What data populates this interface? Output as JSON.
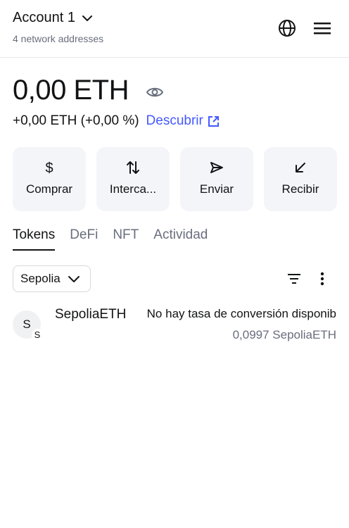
{
  "header": {
    "account_name": "Account 1",
    "addresses_label": "4 network addresses"
  },
  "balance": {
    "amount": "0,00 ETH",
    "change": "+0,00 ETH (+0,00 %)",
    "discover_label": "Descubrir"
  },
  "actions": [
    {
      "label": "Comprar",
      "icon": "dollar-icon"
    },
    {
      "label": "Interca...",
      "icon": "swap-icon"
    },
    {
      "label": "Enviar",
      "icon": "send-icon"
    },
    {
      "label": "Recibir",
      "icon": "receive-icon"
    }
  ],
  "tabs": [
    {
      "label": "Tokens",
      "active": true
    },
    {
      "label": "DeFi",
      "active": false
    },
    {
      "label": "NFT",
      "active": false
    },
    {
      "label": "Actividad",
      "active": false
    }
  ],
  "network_filter": {
    "selected": "Sepolia"
  },
  "tokens": [
    {
      "avatar_letter": "S",
      "badge_letter": "S",
      "name": "SepoliaETH",
      "rate": "No hay tasa de conversión disponib",
      "amount": "0,0997 SepoliaETH"
    }
  ],
  "colors": {
    "accent": "#4459ff",
    "text": "#121314",
    "muted": "#686e7d",
    "card": "#f3f5f9"
  }
}
